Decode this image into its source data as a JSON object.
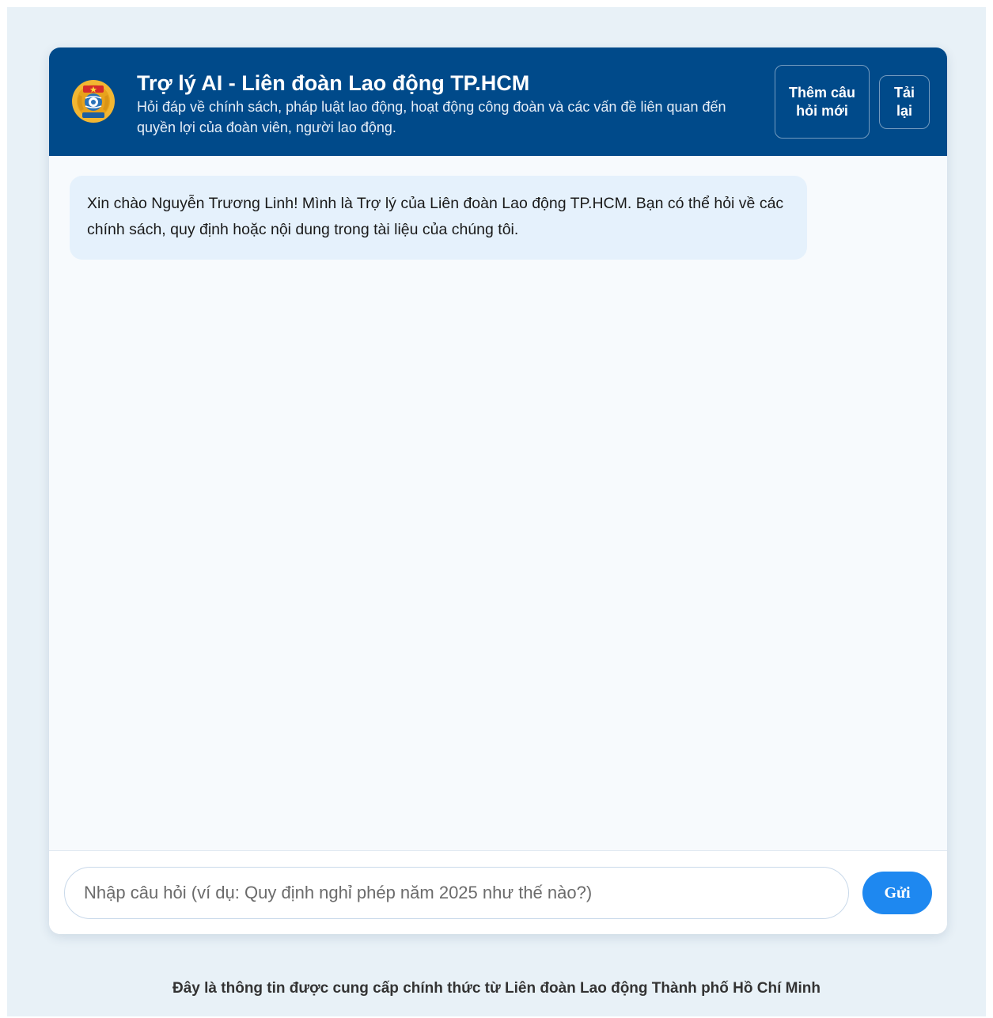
{
  "header": {
    "title": "Trợ lý AI - Liên đoàn Lao động TP.HCM",
    "subtitle": "Hỏi đáp về chính sách, pháp luật lao động, hoạt động công đoàn và các vấn đề liên quan đến quyền lợi của đoàn viên, người lao động.",
    "new_question_label": "Thêm câu hỏi mới",
    "reload_label": "Tải lại",
    "logo_icon": "trade-union-emblem-icon"
  },
  "messages": [
    {
      "role": "assistant",
      "text": "Xin chào Nguyễn Trương Linh! Mình là Trợ lý của Liên đoàn Lao động TP.HCM. Bạn có thể hỏi về các chính sách, quy định hoặc nội dung trong tài liệu của chúng tôi."
    }
  ],
  "composer": {
    "value": "",
    "placeholder": "Nhập câu hỏi (ví dụ: Quy định nghỉ phép năm 2025 như thế nào?)",
    "send_label": "Gửi"
  },
  "footer": {
    "text": "Đây là thông tin được cung cấp chính thức từ Liên đoàn Lao động Thành phố Hồ Chí Minh"
  },
  "colors": {
    "header_bg": "#004a8a",
    "page_bg": "#e8f1f7",
    "bubble_bg": "#e5f1fc",
    "send_button": "#1e88f0"
  }
}
